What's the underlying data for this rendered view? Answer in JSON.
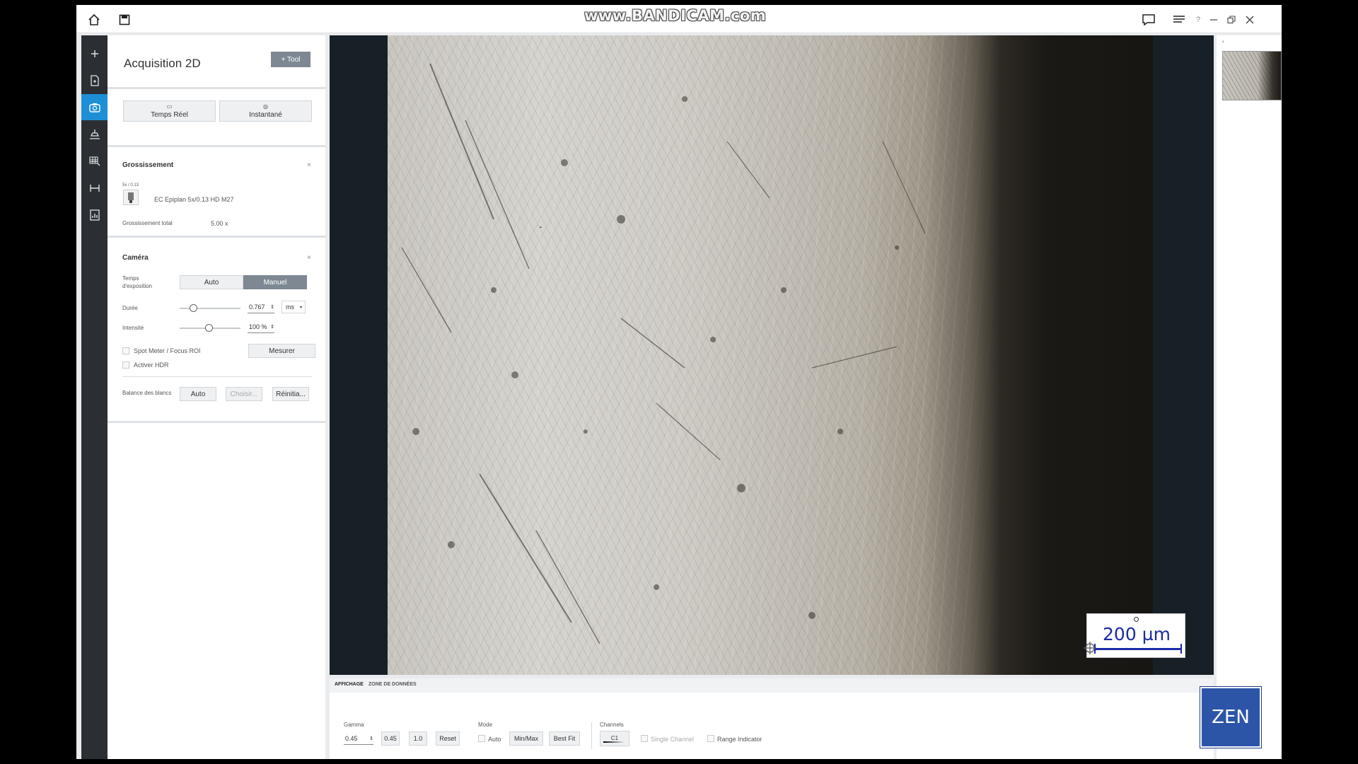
{
  "watermark": "www.BANDICAM.com",
  "titlebar": {
    "help": "?",
    "icons": [
      "home-icon",
      "save-icon",
      "chat-icon",
      "menu-icon",
      "minimize-icon",
      "restore-icon",
      "close-icon"
    ]
  },
  "left_toolbar": {
    "icons": [
      "plus-icon",
      "document-icon",
      "camera-icon",
      "stage-icon",
      "grid-icon",
      "measure-icon",
      "report-icon"
    ]
  },
  "panel": {
    "title": "Acquisition 2D",
    "tool_button": "+ Tool",
    "mode_buttons": [
      {
        "label": "Temps Réel",
        "icon": "live-icon"
      },
      {
        "label": "Instantané",
        "icon": "snap-camera-icon"
      }
    ],
    "magnification": {
      "title": "Grossissement",
      "close": "×",
      "objective_badge": "5x / 0.13",
      "objective_name": "EC Epiplan 5x/0.13 HD M27",
      "total_label": "Grossissement total",
      "total_value": "5.00 x"
    },
    "camera": {
      "title": "Caméra",
      "close": "×",
      "exposure_label_1": "Temps",
      "exposure_label_2": "d'exposition",
      "auto": "Auto",
      "manual": "Manuel",
      "duration_label": "Durée",
      "duration_value": "0.767",
      "duration_unit": "ms",
      "intensity_label": "Intensité",
      "intensity_value": "100 %",
      "spot_meter": "Spot Meter / Focus ROI",
      "measure": "Mesurer",
      "hdr": "Activer HDR",
      "white_balance": "Balance des blancs",
      "wb_auto": "Auto",
      "wb_choose": "Choisir...",
      "wb_reset": "Réinitia..."
    }
  },
  "viewer": {
    "scalebar": "200 µm"
  },
  "bottom": {
    "tabs": [
      "AFFICHAGE",
      "ZONE DE DONNÉES"
    ],
    "gamma_label": "Gamma",
    "gamma_value": "0.45",
    "gamma_preset_1": "0.45",
    "gamma_preset_2": "1.0",
    "reset": "Reset",
    "mode_label": "Mode",
    "mode_auto": "Auto",
    "mode_minmax": "Min/Max",
    "mode_bestfit": "Best Fit",
    "channels_label": "Channels",
    "channel": "C1",
    "single_channel": "Single Channel",
    "range_indicator": "Range Indicator"
  },
  "logo": "ZEN"
}
